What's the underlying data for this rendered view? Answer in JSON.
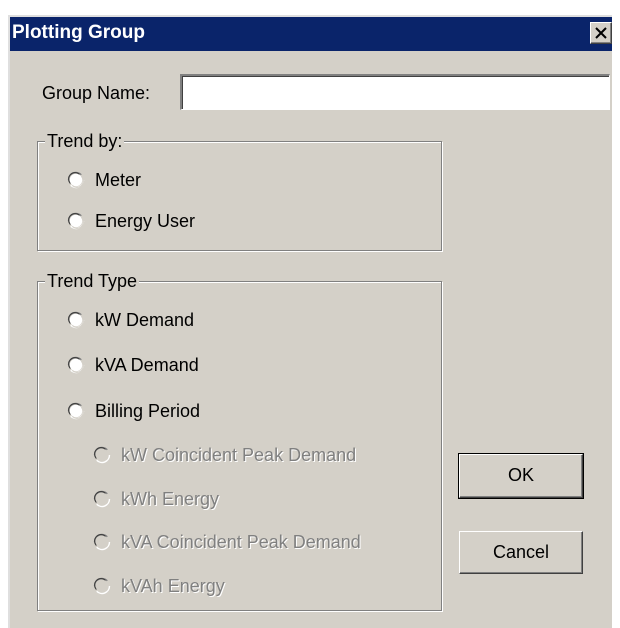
{
  "window": {
    "title": "Plotting Group",
    "close_icon": "close-icon"
  },
  "form": {
    "group_name_label": "Group Name:",
    "group_name_value": "",
    "group_name_placeholder": ""
  },
  "trend_by": {
    "legend": "Trend by:",
    "options": [
      {
        "label": "Meter",
        "selected": false,
        "enabled": true
      },
      {
        "label": "Energy User",
        "selected": false,
        "enabled": true
      }
    ]
  },
  "trend_type": {
    "legend": "Trend Type",
    "options": [
      {
        "label": "kW Demand",
        "selected": false,
        "enabled": true
      },
      {
        "label": "kVA Demand",
        "selected": false,
        "enabled": true
      },
      {
        "label": "Billing Period",
        "selected": false,
        "enabled": true
      }
    ],
    "billing_sub_options": [
      {
        "label": "kW Coincident Peak Demand",
        "selected": false,
        "enabled": false
      },
      {
        "label": "kWh Energy",
        "selected": false,
        "enabled": false
      },
      {
        "label": "kVA Coincident Peak Demand",
        "selected": false,
        "enabled": false
      },
      {
        "label": "kVAh Energy",
        "selected": false,
        "enabled": false
      }
    ]
  },
  "buttons": {
    "ok_label": "OK",
    "cancel_label": "Cancel"
  },
  "colors": {
    "title_bar": "#0a246a",
    "face": "#d4d0c8",
    "disabled_text": "#808080"
  }
}
